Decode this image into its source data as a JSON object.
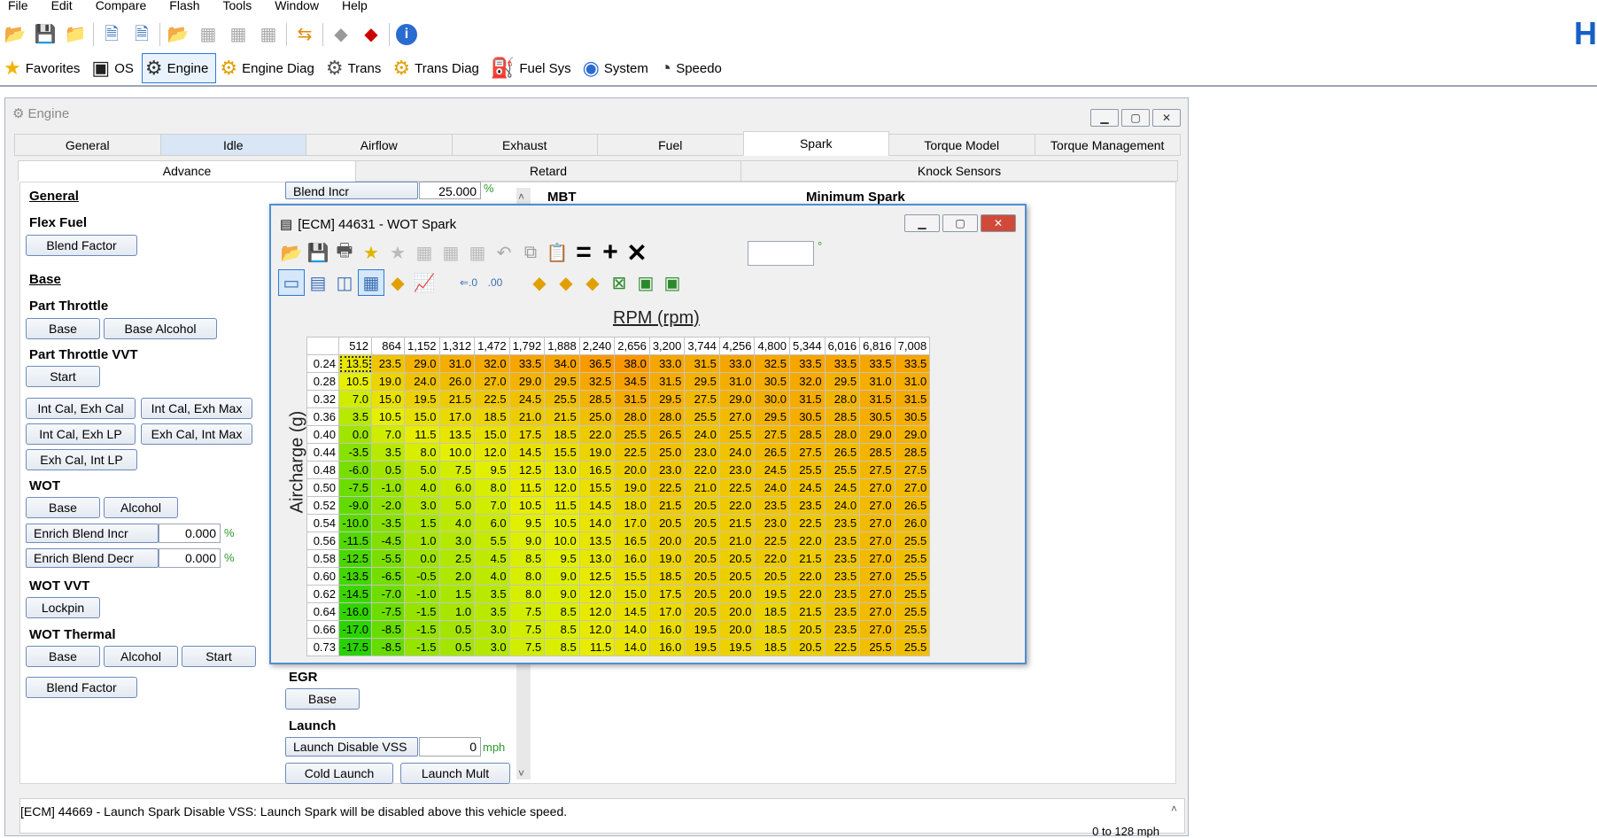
{
  "menu": [
    "File",
    "Edit",
    "Compare",
    "Flash",
    "Tools",
    "Window",
    "Help"
  ],
  "toolbar_icons": [
    "open-icon",
    "save-icon",
    "open-folder-icon",
    "file-info-icon",
    "file-history-icon",
    "open-recent-icon",
    "table-icon",
    "table-icon",
    "table-icon",
    "compare-icon",
    "eraser-icon",
    "flash-icon",
    "info-icon"
  ],
  "nav": [
    {
      "label": "Favorites",
      "icon": "star-icon",
      "glyph": "★",
      "color": "#f0b400"
    },
    {
      "label": "OS",
      "icon": "chip-icon",
      "glyph": "▣",
      "color": "#222"
    },
    {
      "label": "Engine",
      "icon": "engine-icon",
      "glyph": "⚙",
      "color": "#333",
      "active": true
    },
    {
      "label": "Engine Diag",
      "icon": "engine-diag-icon",
      "glyph": "⚙",
      "color": "#e0a000"
    },
    {
      "label": "Trans",
      "icon": "gear-icon",
      "glyph": "⚙",
      "color": "#555"
    },
    {
      "label": "Trans Diag",
      "icon": "gear-diag-icon",
      "glyph": "⚙",
      "color": "#e0a000"
    },
    {
      "label": "Fuel Sys",
      "icon": "fuel-icon",
      "glyph": "⛽",
      "color": "#111"
    },
    {
      "label": "System",
      "icon": "system-icon",
      "glyph": "◉",
      "color": "#2a6bd0"
    },
    {
      "label": "Speedo",
      "icon": "speedo-icon",
      "glyph": "◔",
      "color": "#333"
    }
  ],
  "engine_window": {
    "title": "Engine",
    "tabs": [
      "General",
      "Idle",
      "Airflow",
      "Exhaust",
      "Fuel",
      "Spark",
      "Torque Model",
      "Torque Management"
    ],
    "subtabs": [
      "Advance",
      "Retard",
      "Knock Sensors"
    ]
  },
  "left_panel": {
    "general": "General",
    "flex_fuel": "Flex Fuel",
    "blend_factor": "Blend Factor",
    "base_hdr": "Base",
    "part_throttle": "Part Throttle",
    "pt_base": "Base",
    "pt_base_alcohol": "Base Alcohol",
    "pt_vvt": "Part Throttle VVT",
    "pt_vvt_start": "Start",
    "int_cal_exh_cal": "Int Cal, Exh Cal",
    "int_cal_exh_max": "Int Cal, Exh Max",
    "int_cal_exh_lp": "Int Cal, Exh LP",
    "exh_cal_int_max": "Exh Cal, Int Max",
    "exh_cal_int_lp": "Exh Cal, Int LP",
    "wot": "WOT",
    "wot_base": "Base",
    "wot_alcohol": "Alcohol",
    "enrich_incr": "Enrich Blend Incr",
    "enrich_incr_val": "0.000",
    "enrich_decr": "Enrich Blend Decr",
    "enrich_decr_val": "0.000",
    "pct": "%",
    "wot_vvt": "WOT VVT",
    "lockpin": "Lockpin",
    "wot_thermal": "WOT Thermal",
    "wt_base": "Base",
    "wt_alcohol": "Alcohol",
    "wt_start": "Start",
    "wt_blend": "Blend Factor"
  },
  "mid_panel": {
    "blend_incr": "Blend Incr",
    "blend_incr_val": "25.000",
    "pct": "%",
    "egr": "EGR",
    "egr_base": "Base",
    "launch": "Launch",
    "launch_vss": "Launch Disable VSS",
    "launch_vss_val": "0",
    "mph": "mph",
    "cold_launch": "Cold Launch",
    "launch_mult": "Launch Mult"
  },
  "right_headers": {
    "mbt": "MBT",
    "min_spark": "Minimum Spark"
  },
  "status": {
    "text": "[ECM] 44669 - Launch Spark Disable VSS: Launch Spark will be disabled above this vehicle speed.",
    "range": "0 to 128 mph"
  },
  "wot_window": {
    "title": "[ECM] 44631 - WOT Spark",
    "xlabel": "RPM (rpm)",
    "ylabel": "Aircharge (g)",
    "edit_unit": "°"
  },
  "chart_data": {
    "type": "table",
    "title": "[ECM] 44631 - WOT Spark",
    "xlabel": "RPM (rpm)",
    "ylabel": "Aircharge (g)",
    "columns": [
      "512",
      "864",
      "1,152",
      "1,312",
      "1,472",
      "1,792",
      "1,888",
      "2,240",
      "2,656",
      "3,200",
      "3,744",
      "4,256",
      "4,800",
      "5,344",
      "6,016",
      "6,816",
      "7,008"
    ],
    "rows": [
      "0.24",
      "0.28",
      "0.32",
      "0.36",
      "0.40",
      "0.44",
      "0.48",
      "0.50",
      "0.52",
      "0.54",
      "0.56",
      "0.58",
      "0.60",
      "0.62",
      "0.64",
      "0.66",
      "0.73"
    ],
    "values": [
      [
        "13.5",
        "23.5",
        "29.0",
        "31.0",
        "32.0",
        "33.5",
        "34.0",
        "36.5",
        "38.0",
        "33.0",
        "31.5",
        "33.0",
        "32.5",
        "33.5",
        "33.5",
        "33.5",
        "33.5"
      ],
      [
        "10.5",
        "19.0",
        "24.0",
        "26.0",
        "27.0",
        "29.0",
        "29.5",
        "32.5",
        "34.5",
        "31.5",
        "29.5",
        "31.0",
        "30.5",
        "32.0",
        "29.5",
        "31.0",
        "31.0"
      ],
      [
        "7.0",
        "15.0",
        "19.5",
        "21.5",
        "22.5",
        "24.5",
        "25.5",
        "28.5",
        "31.5",
        "29.5",
        "27.5",
        "29.0",
        "30.0",
        "31.5",
        "28.0",
        "31.5",
        "31.5"
      ],
      [
        "3.5",
        "10.5",
        "15.0",
        "17.0",
        "18.5",
        "21.0",
        "21.5",
        "25.0",
        "28.0",
        "28.0",
        "25.5",
        "27.0",
        "29.5",
        "30.5",
        "28.5",
        "30.5",
        "30.5"
      ],
      [
        "0.0",
        "7.0",
        "11.5",
        "13.5",
        "15.0",
        "17.5",
        "18.5",
        "22.0",
        "25.5",
        "26.5",
        "24.0",
        "25.5",
        "27.5",
        "28.5",
        "28.0",
        "29.0",
        "29.0"
      ],
      [
        "-3.5",
        "3.5",
        "8.0",
        "10.0",
        "12.0",
        "14.5",
        "15.5",
        "19.0",
        "22.5",
        "25.0",
        "23.0",
        "24.0",
        "26.5",
        "27.5",
        "26.5",
        "28.5",
        "28.5"
      ],
      [
        "-6.0",
        "0.5",
        "5.0",
        "7.5",
        "9.5",
        "12.5",
        "13.0",
        "16.5",
        "20.0",
        "23.0",
        "22.0",
        "23.0",
        "24.5",
        "25.5",
        "25.5",
        "27.5",
        "27.5"
      ],
      [
        "-7.5",
        "-1.0",
        "4.0",
        "6.0",
        "8.0",
        "11.5",
        "12.0",
        "15.5",
        "19.0",
        "22.5",
        "21.0",
        "22.5",
        "24.0",
        "24.5",
        "24.5",
        "27.0",
        "27.0"
      ],
      [
        "-9.0",
        "-2.0",
        "3.0",
        "5.0",
        "7.0",
        "10.5",
        "11.5",
        "14.5",
        "18.0",
        "21.5",
        "20.5",
        "22.0",
        "23.5",
        "23.5",
        "24.0",
        "27.0",
        "26.5"
      ],
      [
        "-10.0",
        "-3.5",
        "1.5",
        "4.0",
        "6.0",
        "9.5",
        "10.5",
        "14.0",
        "17.0",
        "20.5",
        "20.5",
        "21.5",
        "23.0",
        "22.5",
        "23.5",
        "27.0",
        "26.0"
      ],
      [
        "-11.5",
        "-4.5",
        "1.0",
        "3.0",
        "5.5",
        "9.0",
        "10.0",
        "13.5",
        "16.5",
        "20.0",
        "20.5",
        "21.0",
        "22.5",
        "22.0",
        "23.5",
        "27.0",
        "25.5"
      ],
      [
        "-12.5",
        "-5.5",
        "0.0",
        "2.5",
        "4.5",
        "8.5",
        "9.5",
        "13.0",
        "16.0",
        "19.0",
        "20.5",
        "20.5",
        "22.0",
        "21.5",
        "23.5",
        "27.0",
        "25.5"
      ],
      [
        "-13.5",
        "-6.5",
        "-0.5",
        "2.0",
        "4.0",
        "8.0",
        "9.0",
        "12.5",
        "15.5",
        "18.5",
        "20.5",
        "20.5",
        "20.5",
        "22.0",
        "23.5",
        "27.0",
        "25.5"
      ],
      [
        "-14.5",
        "-7.0",
        "-1.0",
        "1.5",
        "3.5",
        "8.0",
        "9.0",
        "12.0",
        "15.0",
        "17.5",
        "20.5",
        "20.0",
        "19.5",
        "22.0",
        "23.5",
        "27.0",
        "25.5"
      ],
      [
        "-16.0",
        "-7.5",
        "-1.5",
        "1.0",
        "3.5",
        "7.5",
        "8.5",
        "12.0",
        "14.5",
        "17.0",
        "20.5",
        "20.0",
        "18.5",
        "21.5",
        "23.5",
        "27.0",
        "25.5"
      ],
      [
        "-17.0",
        "-8.5",
        "-1.5",
        "0.5",
        "3.0",
        "7.5",
        "8.5",
        "12.0",
        "14.0",
        "16.0",
        "19.5",
        "20.0",
        "18.5",
        "20.5",
        "23.5",
        "27.0",
        "25.5"
      ],
      [
        "-17.5",
        "-8.5",
        "-1.5",
        "0.5",
        "3.0",
        "7.5",
        "8.5",
        "11.5",
        "14.0",
        "16.0",
        "19.5",
        "19.5",
        "18.5",
        "20.5",
        "22.5",
        "25.5",
        "25.5"
      ]
    ]
  }
}
